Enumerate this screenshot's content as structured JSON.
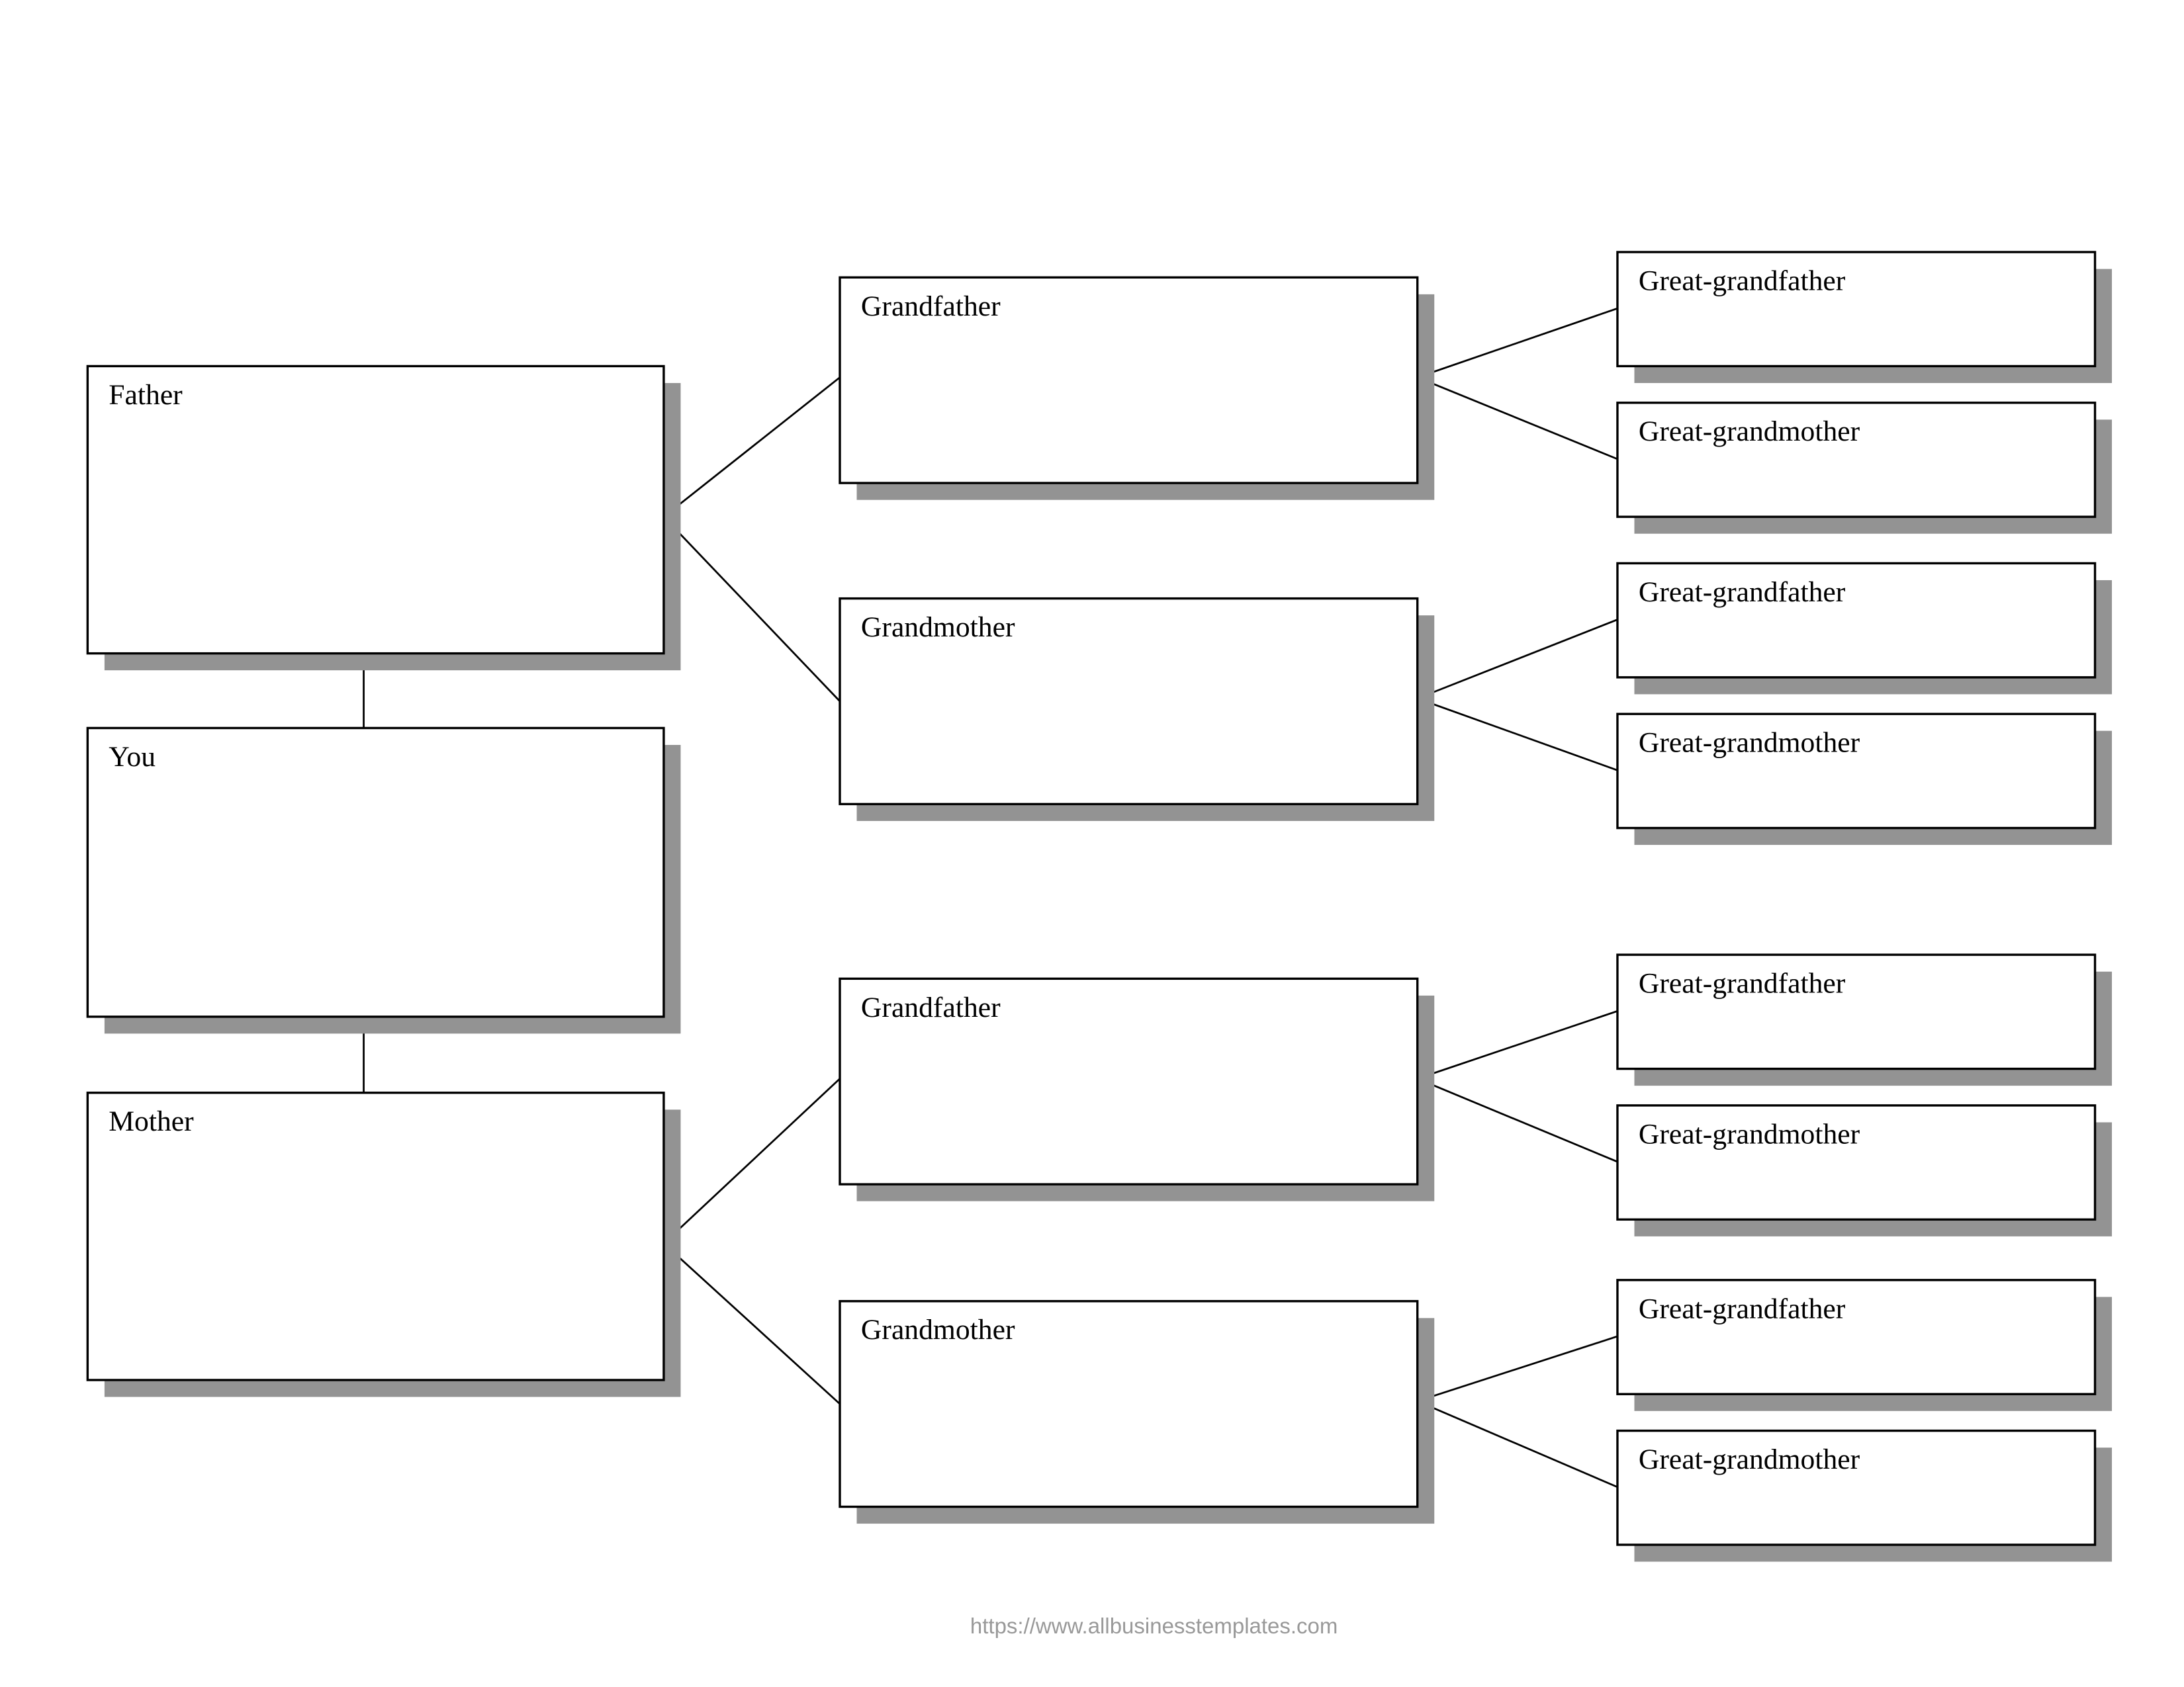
{
  "chart": {
    "self": "You",
    "parents": [
      {
        "label": "Father",
        "grandparents": [
          {
            "label": "Grandfather",
            "great": [
              "Great-grandfather",
              "Great-grandmother"
            ]
          },
          {
            "label": "Grandmother",
            "great": [
              "Great-grandfather",
              "Great-grandmother"
            ]
          }
        ]
      },
      {
        "label": "Mother",
        "grandparents": [
          {
            "label": "Grandfather",
            "great": [
              "Great-grandfather",
              "Great-grandmother"
            ]
          },
          {
            "label": "Grandmother",
            "great": [
              "Great-grandfather",
              "Great-grandmother"
            ]
          }
        ]
      }
    ]
  },
  "footer": {
    "url": "https://www.allbusinesstemplates.com"
  },
  "colors": {
    "shadow": "#939393",
    "border": "#000000",
    "footer_text": "#999999"
  }
}
